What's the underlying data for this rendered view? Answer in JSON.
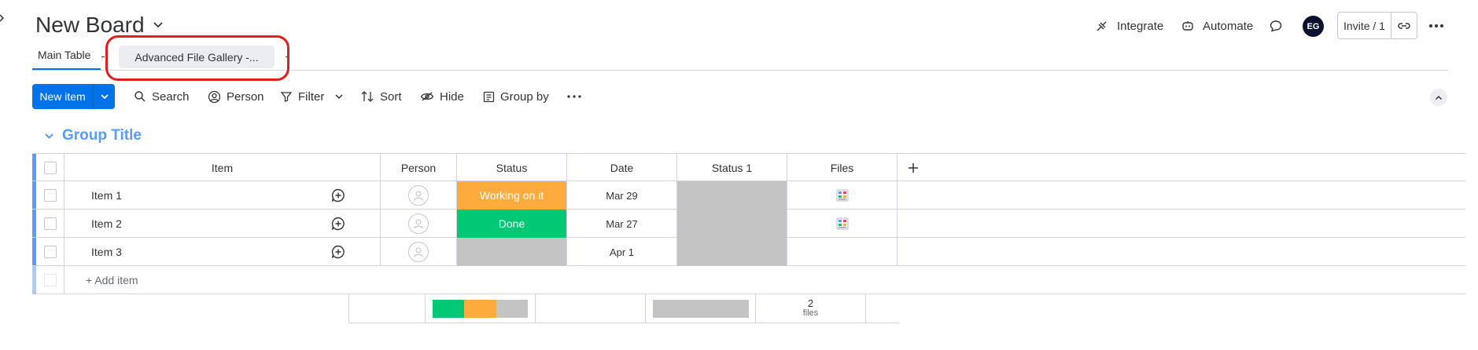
{
  "board": {
    "title": "New Board"
  },
  "header": {
    "integrate_label": "Integrate",
    "automate_label": "Automate",
    "avatar_initials": "EG",
    "invite_label": "Invite / 1"
  },
  "tabs": [
    {
      "label": "Main Table",
      "active": true
    },
    {
      "label": "Advanced File Gallery -...",
      "active": false,
      "highlighted": true
    }
  ],
  "toolbar": {
    "new_item_label": "New item",
    "search_label": "Search",
    "person_label": "Person",
    "filter_label": "Filter",
    "sort_label": "Sort",
    "hide_label": "Hide",
    "group_by_label": "Group by"
  },
  "group": {
    "title": "Group Title",
    "color": "#579bfc",
    "columns": [
      "Item",
      "Person",
      "Status",
      "Date",
      "Status 1",
      "Files"
    ],
    "rows": [
      {
        "item": "Item 1",
        "status": "Working on it",
        "status_color": "#fdab3d",
        "date": "Mar 29",
        "status1_color": "#c4c4c4",
        "has_file": true
      },
      {
        "item": "Item 2",
        "status": "Done",
        "status_color": "#00c875",
        "date": "Mar 27",
        "status1_color": "#c4c4c4",
        "has_file": true
      },
      {
        "item": "Item 3",
        "status": "",
        "status_color": "#c4c4c4",
        "date": "Apr 1",
        "status1_color": "#c4c4c4",
        "has_file": false
      }
    ],
    "add_item_label": "+ Add item",
    "summary": {
      "status_segments": [
        {
          "color": "#00c875",
          "fraction": 0.333
        },
        {
          "color": "#fdab3d",
          "fraction": 0.333
        },
        {
          "color": "#c4c4c4",
          "fraction": 0.334
        }
      ],
      "status1_color": "#c4c4c4",
      "files_count": "2",
      "files_unit": "files"
    }
  },
  "colors": {
    "accent": "#0073ea",
    "highlight_annotation": "#e0201a"
  }
}
